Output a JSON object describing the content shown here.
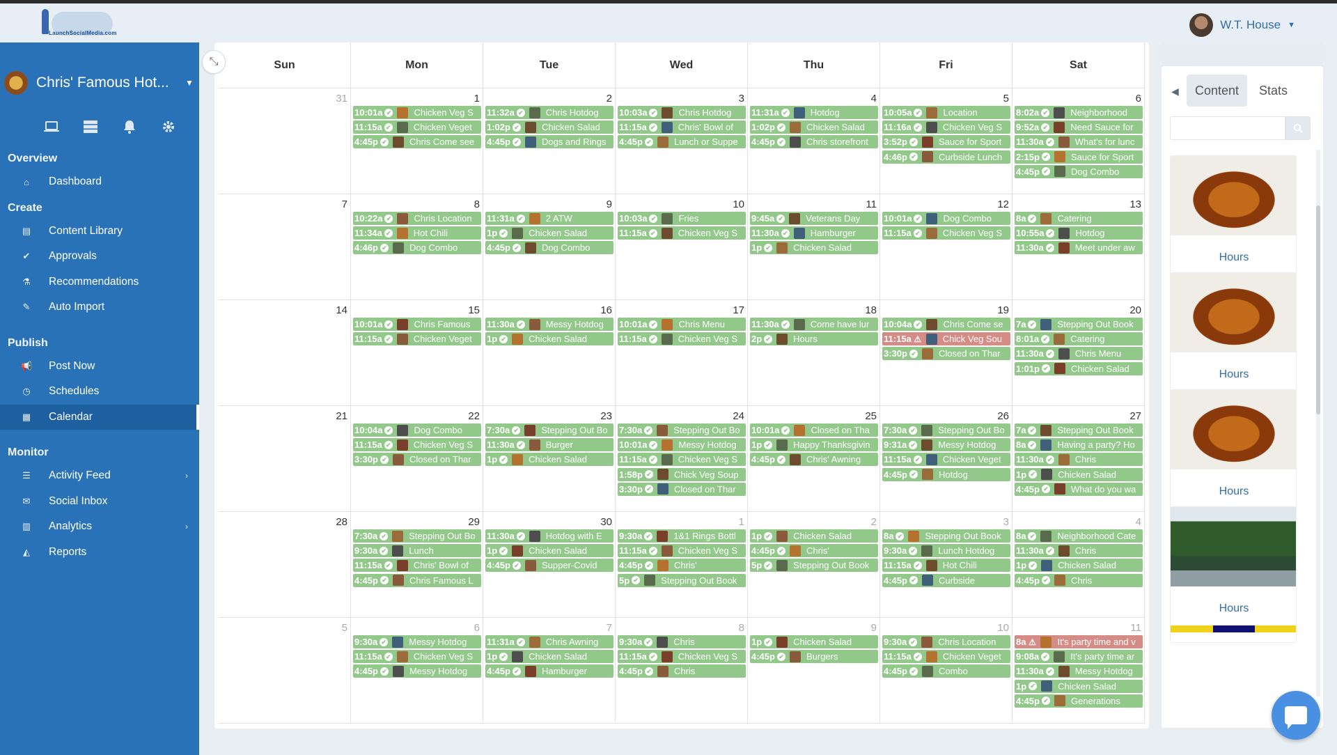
{
  "header": {
    "logo_text": "LaunchSocialMedia.com",
    "user_name": "W.T. House"
  },
  "sidebar": {
    "brand": "Chris' Famous Hot...",
    "icons": [
      "laptop-icon",
      "server-icon",
      "bell-icon",
      "gear-icon"
    ],
    "sections": [
      {
        "title": "Overview",
        "items": [
          {
            "label": "Dashboard",
            "icon": "home-icon"
          }
        ]
      },
      {
        "title": "Create",
        "items": [
          {
            "label": "Content Library",
            "icon": "file-image-icon"
          },
          {
            "label": "Approvals",
            "icon": "check-circle-icon"
          },
          {
            "label": "Recommendations",
            "icon": "flask-icon"
          },
          {
            "label": "Auto Import",
            "icon": "magic-wand-icon"
          }
        ]
      },
      {
        "title": "Publish",
        "items": [
          {
            "label": "Post Now",
            "icon": "megaphone-icon"
          },
          {
            "label": "Schedules",
            "icon": "clock-icon"
          },
          {
            "label": "Calendar",
            "icon": "calendar-icon",
            "active": true
          }
        ]
      },
      {
        "title": "Monitor",
        "items": [
          {
            "label": "Activity Feed",
            "icon": "list-icon",
            "has_submenu": true
          },
          {
            "label": "Social Inbox",
            "icon": "envelope-icon"
          },
          {
            "label": "Analytics",
            "icon": "bar-chart-icon",
            "has_submenu": true
          },
          {
            "label": "Reports",
            "icon": "area-chart-icon"
          }
        ]
      }
    ]
  },
  "calendar": {
    "weekdays": [
      "Sun",
      "Mon",
      "Tue",
      "Wed",
      "Thu",
      "Fri",
      "Sat"
    ],
    "weeks": [
      [
        {
          "num": "31",
          "muted": true,
          "events": []
        },
        {
          "num": "1",
          "events": [
            [
              "10:01a",
              "Chicken Veg S"
            ],
            [
              "11:15a",
              "Chicken Veget"
            ],
            [
              "4:45p",
              "Chris Come see"
            ]
          ]
        },
        {
          "num": "2",
          "events": [
            [
              "11:32a",
              "Chris Hotdog"
            ],
            [
              "1:02p",
              "Chicken Salad"
            ],
            [
              "4:45p",
              "Dogs and Rings"
            ]
          ]
        },
        {
          "num": "3",
          "events": [
            [
              "10:03a",
              "Chris Hotdog"
            ],
            [
              "11:15a",
              "Chris' Bowl of"
            ],
            [
              "4:45p",
              "Lunch or Suppe"
            ]
          ]
        },
        {
          "num": "4",
          "events": [
            [
              "11:31a",
              "Hotdog"
            ],
            [
              "1:02p",
              "Chicken Salad"
            ],
            [
              "4:45p",
              "Chris storefront"
            ]
          ]
        },
        {
          "num": "5",
          "events": [
            [
              "10:05a",
              "Location"
            ],
            [
              "11:16a",
              "Chicken Veg S"
            ],
            [
              "3:52p",
              "Sauce for Sport"
            ],
            [
              "4:46p",
              "Curbside Lunch"
            ]
          ]
        },
        {
          "num": "6",
          "events": [
            [
              "8:02a",
              "Neighborhood"
            ],
            [
              "9:52a",
              "Need Sauce for"
            ],
            [
              "11:30a",
              "What's for lunc"
            ],
            [
              "2:15p",
              "Sauce for Sport"
            ],
            [
              "4:45p",
              "Dog Combo"
            ]
          ]
        }
      ],
      [
        {
          "num": "7",
          "events": []
        },
        {
          "num": "8",
          "events": [
            [
              "10:22a",
              "Chris Location"
            ],
            [
              "11:34a",
              "Hot Chili"
            ],
            [
              "4:46p",
              "Dog Combo"
            ]
          ]
        },
        {
          "num": "9",
          "events": [
            [
              "11:31a",
              "2 ATW"
            ],
            [
              "1p",
              "Chicken Salad"
            ],
            [
              "4:45p",
              "Dog Combo"
            ]
          ]
        },
        {
          "num": "10",
          "events": [
            [
              "10:03a",
              "Fries"
            ],
            [
              "11:15a",
              "Chicken Veg S"
            ]
          ]
        },
        {
          "num": "11",
          "events": [
            [
              "9:45a",
              "Veterans Day"
            ],
            [
              "11:30a",
              "Hamburger"
            ],
            [
              "1p",
              "Chicken Salad"
            ]
          ]
        },
        {
          "num": "12",
          "events": [
            [
              "10:01a",
              "Dog Combo"
            ],
            [
              "11:15a",
              "Chicken Veg S"
            ]
          ]
        },
        {
          "num": "13",
          "events": [
            [
              "8a",
              "Catering"
            ],
            [
              "10:55a",
              "Hotdog"
            ],
            [
              "11:30a",
              "Meet under aw"
            ]
          ]
        }
      ],
      [
        {
          "num": "14",
          "events": []
        },
        {
          "num": "15",
          "events": [
            [
              "10:01a",
              "Chris Famous"
            ],
            [
              "11:15a",
              "Chicken Veget"
            ]
          ]
        },
        {
          "num": "16",
          "events": [
            [
              "11:30a",
              "Messy Hotdog"
            ],
            [
              "1p",
              "Chicken Salad"
            ]
          ]
        },
        {
          "num": "17",
          "events": [
            [
              "10:01a",
              "Chris Menu"
            ],
            [
              "11:15a",
              "Chicken Veg S"
            ]
          ]
        },
        {
          "num": "18",
          "events": [
            [
              "11:30a",
              "Come have lur"
            ],
            [
              "2p",
              "Hours"
            ]
          ]
        },
        {
          "num": "19",
          "events": [
            [
              "10:04a",
              "Chris Come se"
            ],
            [
              "11:15a",
              "Chick Veg Sou",
              "warn"
            ],
            [
              "3:30p",
              "Closed on Thar"
            ]
          ]
        },
        {
          "num": "20",
          "events": [
            [
              "7a",
              "Stepping Out Book"
            ],
            [
              "8:01a",
              "Catering"
            ],
            [
              "11:30a",
              "Chris Menu"
            ],
            [
              "1:01p",
              "Chicken Salad"
            ]
          ]
        }
      ],
      [
        {
          "num": "21",
          "events": []
        },
        {
          "num": "22",
          "events": [
            [
              "10:04a",
              "Dog Combo"
            ],
            [
              "11:15a",
              "Chicken Veg S"
            ],
            [
              "3:30p",
              "Closed on Thar"
            ]
          ]
        },
        {
          "num": "23",
          "events": [
            [
              "7:30a",
              "Stepping Out Bo"
            ],
            [
              "11:30a",
              "Burger"
            ],
            [
              "1p",
              "Chicken Salad"
            ]
          ]
        },
        {
          "num": "24",
          "events": [
            [
              "7:30a",
              "Stepping Out Bo"
            ],
            [
              "10:01a",
              "Messy Hotdog"
            ],
            [
              "11:15a",
              "Chicken Veg S"
            ],
            [
              "1:58p",
              "Chick Veg Soup"
            ],
            [
              "3:30p",
              "Closed on Thar"
            ]
          ]
        },
        {
          "num": "25",
          "events": [
            [
              "10:01a",
              "Closed on Tha"
            ],
            [
              "1p",
              "Happy Thanksgivin"
            ],
            [
              "4:45p",
              "Chris' Awning"
            ]
          ]
        },
        {
          "num": "26",
          "events": [
            [
              "7:30a",
              "Stepping Out Bo"
            ],
            [
              "9:31a",
              "Messy Hotdog"
            ],
            [
              "11:15a",
              "Chicken Veget"
            ],
            [
              "4:45p",
              "Hotdog"
            ]
          ]
        },
        {
          "num": "27",
          "events": [
            [
              "7a",
              "Stepping Out Book"
            ],
            [
              "8a",
              "Having a party? Ho"
            ],
            [
              "11:30a",
              "Chris"
            ],
            [
              "1p",
              "Chicken Salad"
            ],
            [
              "4:45p",
              "What do you wa"
            ]
          ]
        }
      ],
      [
        {
          "num": "28",
          "events": []
        },
        {
          "num": "29",
          "events": [
            [
              "7:30a",
              "Stepping Out Bo"
            ],
            [
              "9:30a",
              "Lunch"
            ],
            [
              "11:15a",
              "Chris' Bowl of"
            ],
            [
              "4:45p",
              "Chris Famous L"
            ]
          ]
        },
        {
          "num": "30",
          "events": [
            [
              "11:30a",
              "Hotdog with E"
            ],
            [
              "1p",
              "Chicken Salad"
            ],
            [
              "4:45p",
              "Supper-Covid"
            ]
          ]
        },
        {
          "num": "1",
          "muted": true,
          "events": [
            [
              "9:30a",
              "1&1 Rings Bottl"
            ],
            [
              "11:15a",
              "Chicken Veg S"
            ],
            [
              "4:45p",
              "Chris'"
            ],
            [
              "5p",
              "Stepping Out Book"
            ]
          ]
        },
        {
          "num": "2",
          "muted": true,
          "events": [
            [
              "1p",
              "Chicken Salad"
            ],
            [
              "4:45p",
              "Chris'"
            ],
            [
              "5p",
              "Stepping Out Book"
            ]
          ]
        },
        {
          "num": "3",
          "muted": true,
          "events": [
            [
              "8a",
              "Stepping Out Book"
            ],
            [
              "9:30a",
              "Lunch Hotdog"
            ],
            [
              "11:15a",
              "Hot Chili"
            ],
            [
              "4:45p",
              "Curbside"
            ]
          ]
        },
        {
          "num": "4",
          "muted": true,
          "events": [
            [
              "8a",
              "Neighborhood Cate"
            ],
            [
              "11:30a",
              "Chris"
            ],
            [
              "1p",
              "Chicken Salad"
            ],
            [
              "4:45p",
              "Chris"
            ]
          ]
        }
      ],
      [
        {
          "num": "5",
          "muted": true,
          "events": []
        },
        {
          "num": "6",
          "muted": true,
          "events": [
            [
              "9:30a",
              "Messy Hotdog"
            ],
            [
              "11:15a",
              "Chicken Veg S"
            ],
            [
              "4:45p",
              "Messy Hotdog"
            ]
          ]
        },
        {
          "num": "7",
          "muted": true,
          "events": [
            [
              "11:31a",
              "Chris Awning"
            ],
            [
              "1p",
              "Chicken Salad"
            ],
            [
              "4:45p",
              "Hamburger"
            ]
          ]
        },
        {
          "num": "8",
          "muted": true,
          "events": [
            [
              "9:30a",
              "Chris"
            ],
            [
              "11:15a",
              "Chicken Veg S"
            ],
            [
              "4:45p",
              "Chris"
            ]
          ]
        },
        {
          "num": "9",
          "muted": true,
          "events": [
            [
              "1p",
              "Chicken Salad"
            ],
            [
              "4:45p",
              "Burgers"
            ]
          ]
        },
        {
          "num": "10",
          "muted": true,
          "events": [
            [
              "9:30a",
              "Chris Location"
            ],
            [
              "11:15a",
              "Chicken Veget"
            ],
            [
              "4:45p",
              "Combo"
            ]
          ]
        },
        {
          "num": "11",
          "muted": true,
          "events": [
            [
              "8a",
              "It's party time and v",
              "warn"
            ],
            [
              "9:08a",
              "It's party time ar"
            ],
            [
              "11:30a",
              "Messy Hotdog"
            ],
            [
              "1p",
              "Chicken Salad"
            ],
            [
              "4:45p",
              "Generations"
            ]
          ]
        }
      ]
    ]
  },
  "panel": {
    "tabs": [
      "Content",
      "Stats"
    ],
    "active_tab": "Content",
    "search_placeholder": "",
    "cards": [
      {
        "label": "Hours",
        "image": "hotdog-photo",
        "bar_colors": [
          "#f1d21b",
          "#f39ad0",
          "#f1d21b",
          "#4a4a4a",
          "#f1d21b"
        ]
      },
      {
        "label": "Hours",
        "image": "hotdog-photo",
        "bar_colors": [
          "#f1d21b",
          "#f39ad0",
          "#f1d21b"
        ]
      },
      {
        "label": "Hours",
        "image": "hotdog-photo",
        "bar_colors": [
          "#f39ad0",
          "#f1d21b"
        ]
      },
      {
        "label": "Hours",
        "image": "storefront-photo",
        "bar_colors": [
          "#f1d21b",
          "#101070",
          "#f1d21b"
        ]
      }
    ]
  }
}
